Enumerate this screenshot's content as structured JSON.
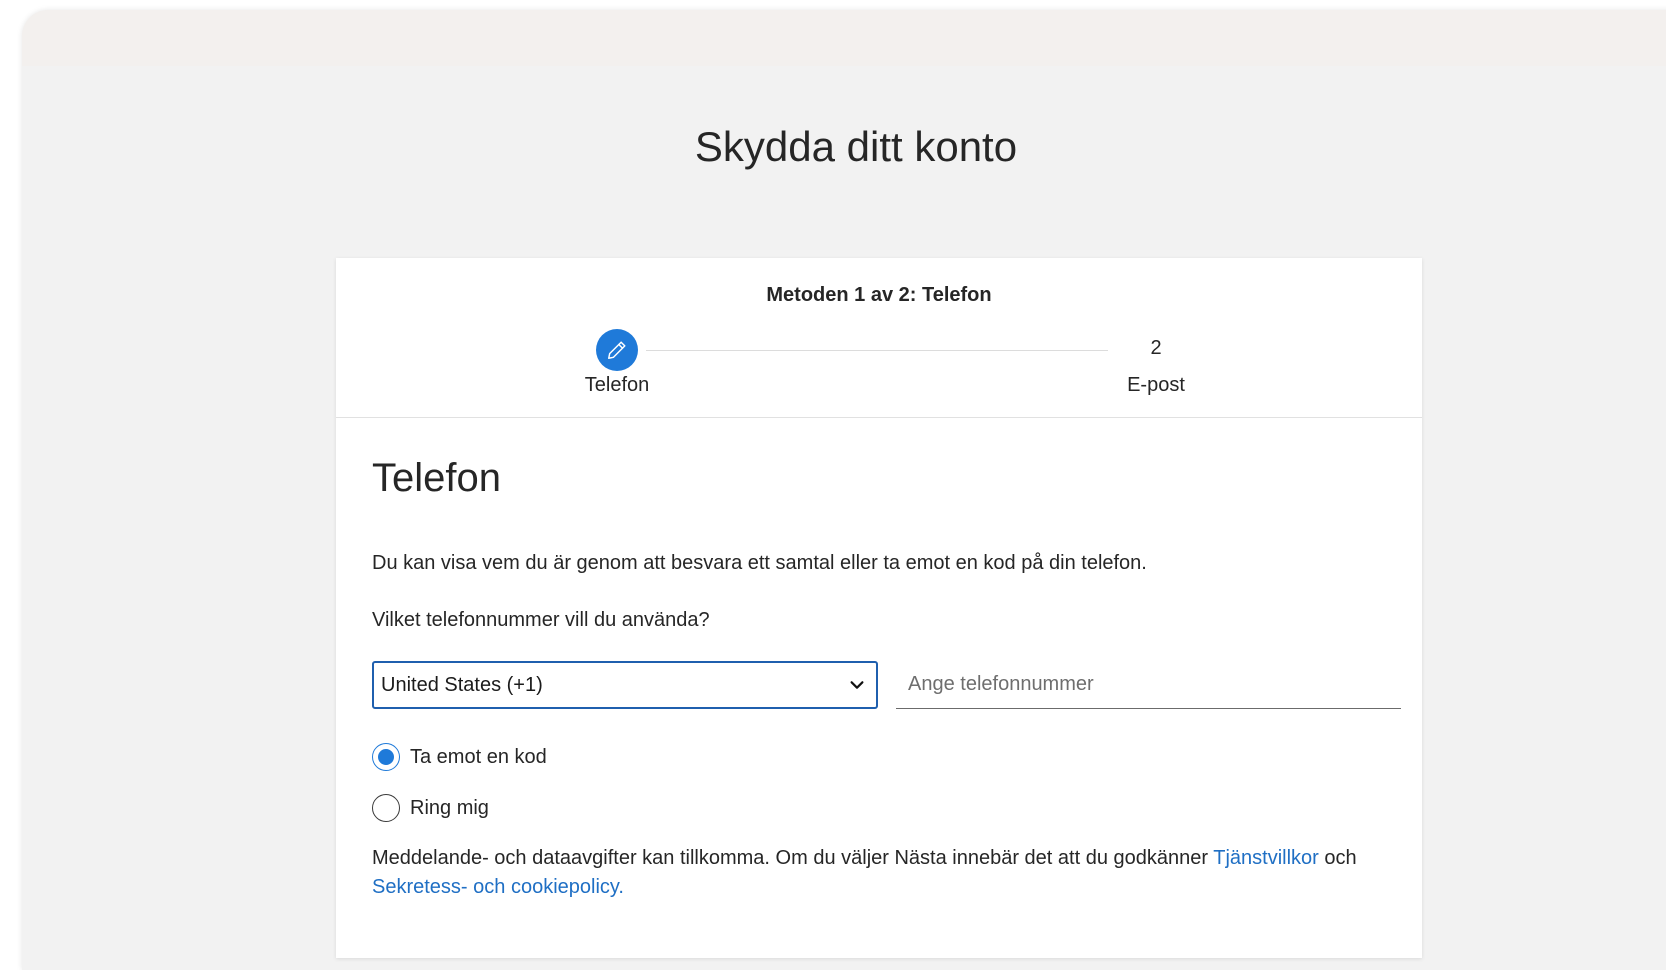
{
  "page": {
    "title": "Skydda ditt konto"
  },
  "steps": {
    "heading": "Metoden 1 av 2: Telefon",
    "items": [
      {
        "number": "1",
        "label": "Telefon",
        "icon": "pencil-icon",
        "active": true
      },
      {
        "number": "2",
        "label": "E-post",
        "active": false
      }
    ]
  },
  "phone_section": {
    "title": "Telefon",
    "description": "Du kan visa vem du är genom att besvara ett samtal eller ta emot en kod på din telefon.",
    "question": "Vilket telefonnummer vill du använda?",
    "country_select": {
      "value": "United States (+1)"
    },
    "phone_input": {
      "value": "",
      "placeholder": "Ange telefonnummer"
    },
    "options": [
      {
        "label": "Ta emot en kod",
        "selected": true
      },
      {
        "label": "Ring mig",
        "selected": false
      }
    ],
    "disclaimer": {
      "text_before": "Meddelande- och dataavgifter kan tillkomma. Om du väljer Nästa innebär det att du godkänner ",
      "terms_link": "Tjänstvillkor",
      "text_middle": " och ",
      "privacy_link": "Sekretess- och cookiepolicy."
    }
  },
  "colors": {
    "accent": "#1f7ad9",
    "link": "#1f6fc4",
    "select_border": "#1f5fae",
    "background": "#f2f2f2"
  }
}
